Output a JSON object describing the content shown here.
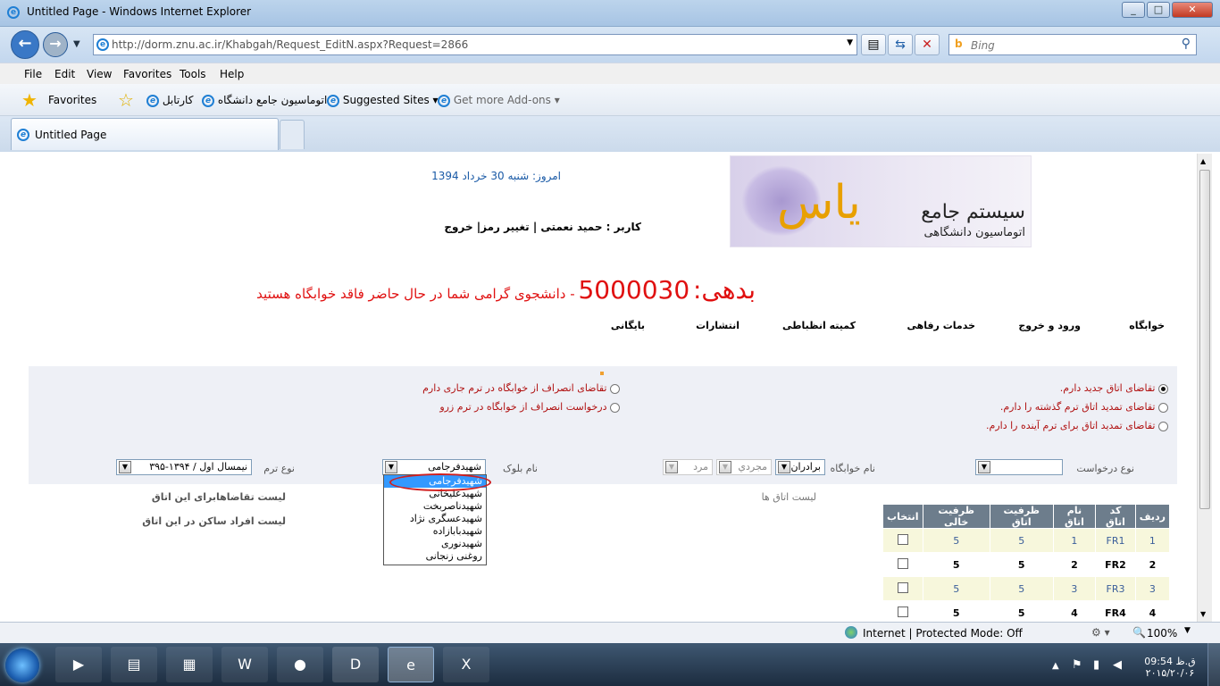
{
  "window": {
    "title": "Untitled Page - Windows Internet Explorer"
  },
  "address": {
    "url": "http://dorm.znu.ac.ir/Khabgah/Request_EditN.aspx?Request=2866",
    "search_placeholder": "Bing"
  },
  "menu": [
    "File",
    "Edit",
    "View",
    "Favorites",
    "Tools",
    "Help"
  ],
  "favorites": {
    "label": "Favorites",
    "links": [
      "کارتابل",
      "اتوماسیون جامع دانشگاه",
      "Suggested Sites ▾",
      "Get more Add-ons ▾"
    ]
  },
  "tab": {
    "label": "Untitled Page"
  },
  "page": {
    "date": "امروز: شنبه 30 خرداد 1394",
    "user": "کاربر : حمید نعمتی | تغییر رمز| خروج",
    "logo_title": "سیستم جامع",
    "logo_subtitle": "اتوماسیون دانشگاهی",
    "logo_mark": "یاس",
    "debt_label": "بدهی:",
    "debt_amount": "5000030",
    "debt_msg": "- دانشجوی گرامی شما در حال حاضر فاقد خوابگاه هستید",
    "nav": [
      "خوابگاه",
      "ورود و خروج",
      "خدمات رفاهی",
      "کمیته انظباطی",
      "انتشارات",
      "بایگانی"
    ],
    "radios_right": [
      {
        "label": "تقاضای اتاق جدید دارم.",
        "checked": true
      },
      {
        "label": "تقاضای تمدید اتاق ترم گذشته را دارم.",
        "checked": false
      },
      {
        "label": "تقاضای تمدید اتاق برای ترم آینده را دارم.",
        "checked": false
      }
    ],
    "radios_left": [
      {
        "label": "تقاضای انصراف از خوابگاه در ترم جاری دارم",
        "checked": false
      },
      {
        "label": "درخواست انصراف از خوابگاه در ترم زرو",
        "checked": false
      }
    ],
    "filters": {
      "request_type_label": "نوع درخواست",
      "dorm_name_label": "نام خوابگاه",
      "dorm_group": "برادران",
      "dorm_status": "مجردي",
      "dorm_gender": "مرد",
      "block_label": "نام بلوک",
      "block_value": "شهیدفرجامی",
      "term_label": "نوع ترم",
      "term_value": "نیمسال اول / ۱۳۹۴-۳۹۵"
    },
    "block_options": [
      "شهیدفرجامی",
      "شهیدعلیخانی",
      "شهیدناصربخت",
      "شهیدعسگری نژاد",
      "شهیدبابازاده",
      "شهیدنوری",
      "روغنی زنجانی"
    ],
    "room_list_label": "لیست اتاق ها",
    "requests_label": "لیست تقاضاهابرای این اتاق",
    "residents_label": "لیست افراد ساکن در این اتاق",
    "table": {
      "headers": [
        "ردیف",
        "کد اتاق",
        "نام اتاق",
        "ظرفیت اتاق",
        "ظرفیت خالی",
        "انتخاب"
      ],
      "rows": [
        [
          "1",
          "FR1",
          "1",
          "5",
          "5"
        ],
        [
          "2",
          "FR2",
          "2",
          "5",
          "5"
        ],
        [
          "3",
          "FR3",
          "3",
          "5",
          "5"
        ],
        [
          "4",
          "FR4",
          "4",
          "5",
          "5"
        ]
      ]
    }
  },
  "status": {
    "zone": "Internet | Protected Mode: Off",
    "zoom": "100%"
  },
  "clock": {
    "time": "09:54 ق.ظ",
    "date": "۲۰۱۵/۲۰/۰۶"
  }
}
